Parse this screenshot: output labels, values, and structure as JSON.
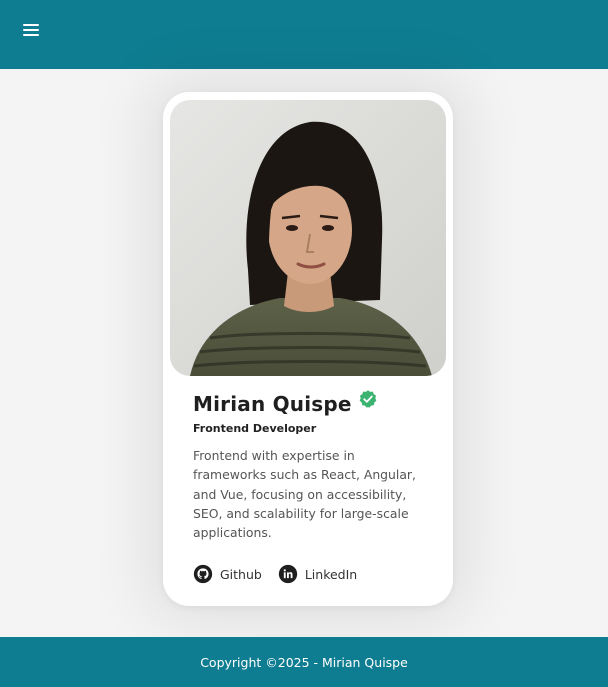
{
  "header": {
    "menu_icon": "hamburger-menu-icon",
    "bg_color": "#0f7d91"
  },
  "profile": {
    "name": "Mirian Quispe",
    "verified_icon": "verified-check-icon",
    "verified_color": "#3cb371",
    "role": "Frontend Developer",
    "bio": "Frontend with expertise in frameworks such as React, Angular, and Vue, focusing on accessibility, SEO, and scalability for large-scale applications.",
    "photo_alt": "Mirian Quispe",
    "links": [
      {
        "label": "Github",
        "icon": "github-icon"
      },
      {
        "label": "LinkedIn",
        "icon": "linkedin-icon"
      }
    ]
  },
  "footer": {
    "copyright": "Copyright ©2025 - Mirian Quispe"
  }
}
